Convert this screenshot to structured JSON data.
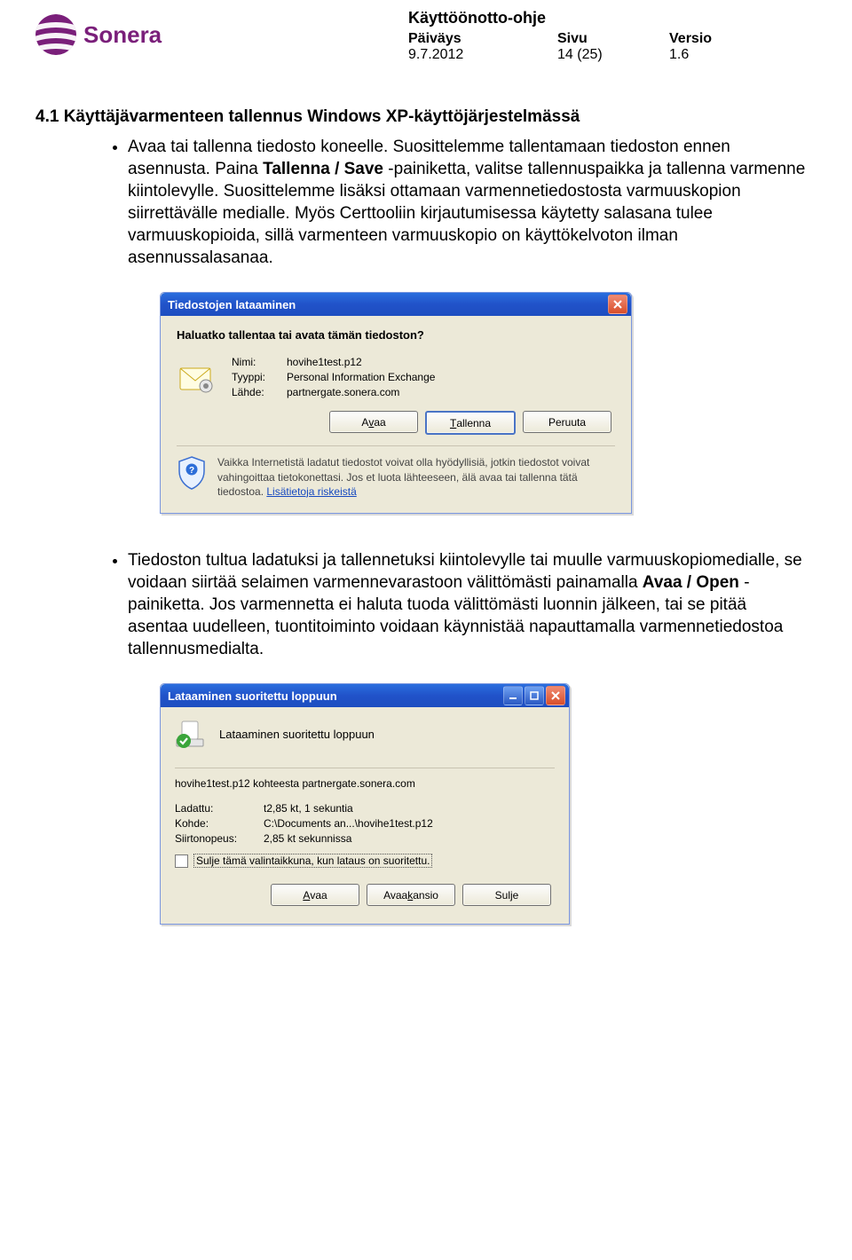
{
  "header": {
    "logo_text": "Sonera",
    "doc_title": "Käyttöönotto-ohje",
    "labels": {
      "date": "Päiväys",
      "page": "Sivu",
      "version": "Versio"
    },
    "values": {
      "date": "9.7.2012",
      "page": "14 (25)",
      "version": "1.6"
    }
  },
  "section": {
    "heading": "4.1 Käyttäjävarmenteen tallennus Windows XP-käyttöjärjestelmässä",
    "bullet1_pre": "Avaa tai tallenna tiedosto koneelle. Suosittelemme tallentamaan tiedoston ennen asennusta. Paina ",
    "bullet1_bold": "Tallenna / Save",
    "bullet1_post": " -painiketta, valitse tallennuspaikka ja tallenna varmenne kiintolevylle. Suosittelemme lisäksi ottamaan varmennetiedostosta varmuuskopion siirrettävälle medialle. Myös Certtooliin kirjautumisessa käytetty salasana tulee varmuuskopioida, sillä varmenteen varmuuskopio on käyttökelvoton ilman asennussalasanaa.",
    "bullet2_pre": "Tiedoston tultua ladatuksi ja tallennetuksi kiintolevylle tai muulle varmuuskopiomedialle, se voidaan siirtää selaimen varmennevarastoon välittömästi painamalla ",
    "bullet2_bold": "Avaa / Open",
    "bullet2_post": " -painiketta. Jos varmennetta ei haluta tuoda välittömästi luonnin jälkeen, tai se pitää asentaa uudelleen, tuontitoiminto voidaan käynnistää napauttamalla varmennetiedostoa tallennusmedialta."
  },
  "file_download": {
    "title": "Tiedostojen lataaminen",
    "prompt": "Haluatko tallentaa tai avata tämän tiedoston?",
    "kv": {
      "name_label": "Nimi:",
      "name_value": "hovihe1test.p12",
      "type_label": "Tyyppi:",
      "type_value": "Personal Information Exchange",
      "source_label": "Lähde:",
      "source_value": "partnergate.sonera.com"
    },
    "buttons": {
      "open_pre": "A",
      "open_mn": "v",
      "open_post": "aa",
      "save_mn": "T",
      "save_post": "allenna",
      "cancel": "Peruuta"
    },
    "warning_text": "Vaikka Internetistä ladatut tiedostot voivat olla hyödyllisiä, jotkin tiedostot voivat vahingoittaa tietokonettasi. Jos et luota lähteeseen, älä avaa tai tallenna tätä tiedostoa. ",
    "warning_link": "Lisätietoja riskeistä"
  },
  "download_complete": {
    "title": "Lataaminen suoritettu loppuun",
    "headline": "Lataaminen suoritettu loppuun",
    "file_line": "hovihe1test.p12 kohteesta partnergate.sonera.com",
    "kv": {
      "loaded_label": "Ladattu:",
      "loaded_value": "t2,85 kt, 1 sekuntia",
      "target_label": "Kohde:",
      "target_value": "C:\\Documents an...\\hovihe1test.p12",
      "speed_label": "Siirtonopeus:",
      "speed_value": "2,85 kt sekunnissa"
    },
    "checkbox_label": "Sulje tämä valintaikkuna, kun lataus on suoritettu.",
    "buttons": {
      "open_mn": "A",
      "open_post": "vaa",
      "openf_pre": "Avaa ",
      "openf_mn": "k",
      "openf_post": "ansio",
      "close": "Sulje"
    }
  }
}
